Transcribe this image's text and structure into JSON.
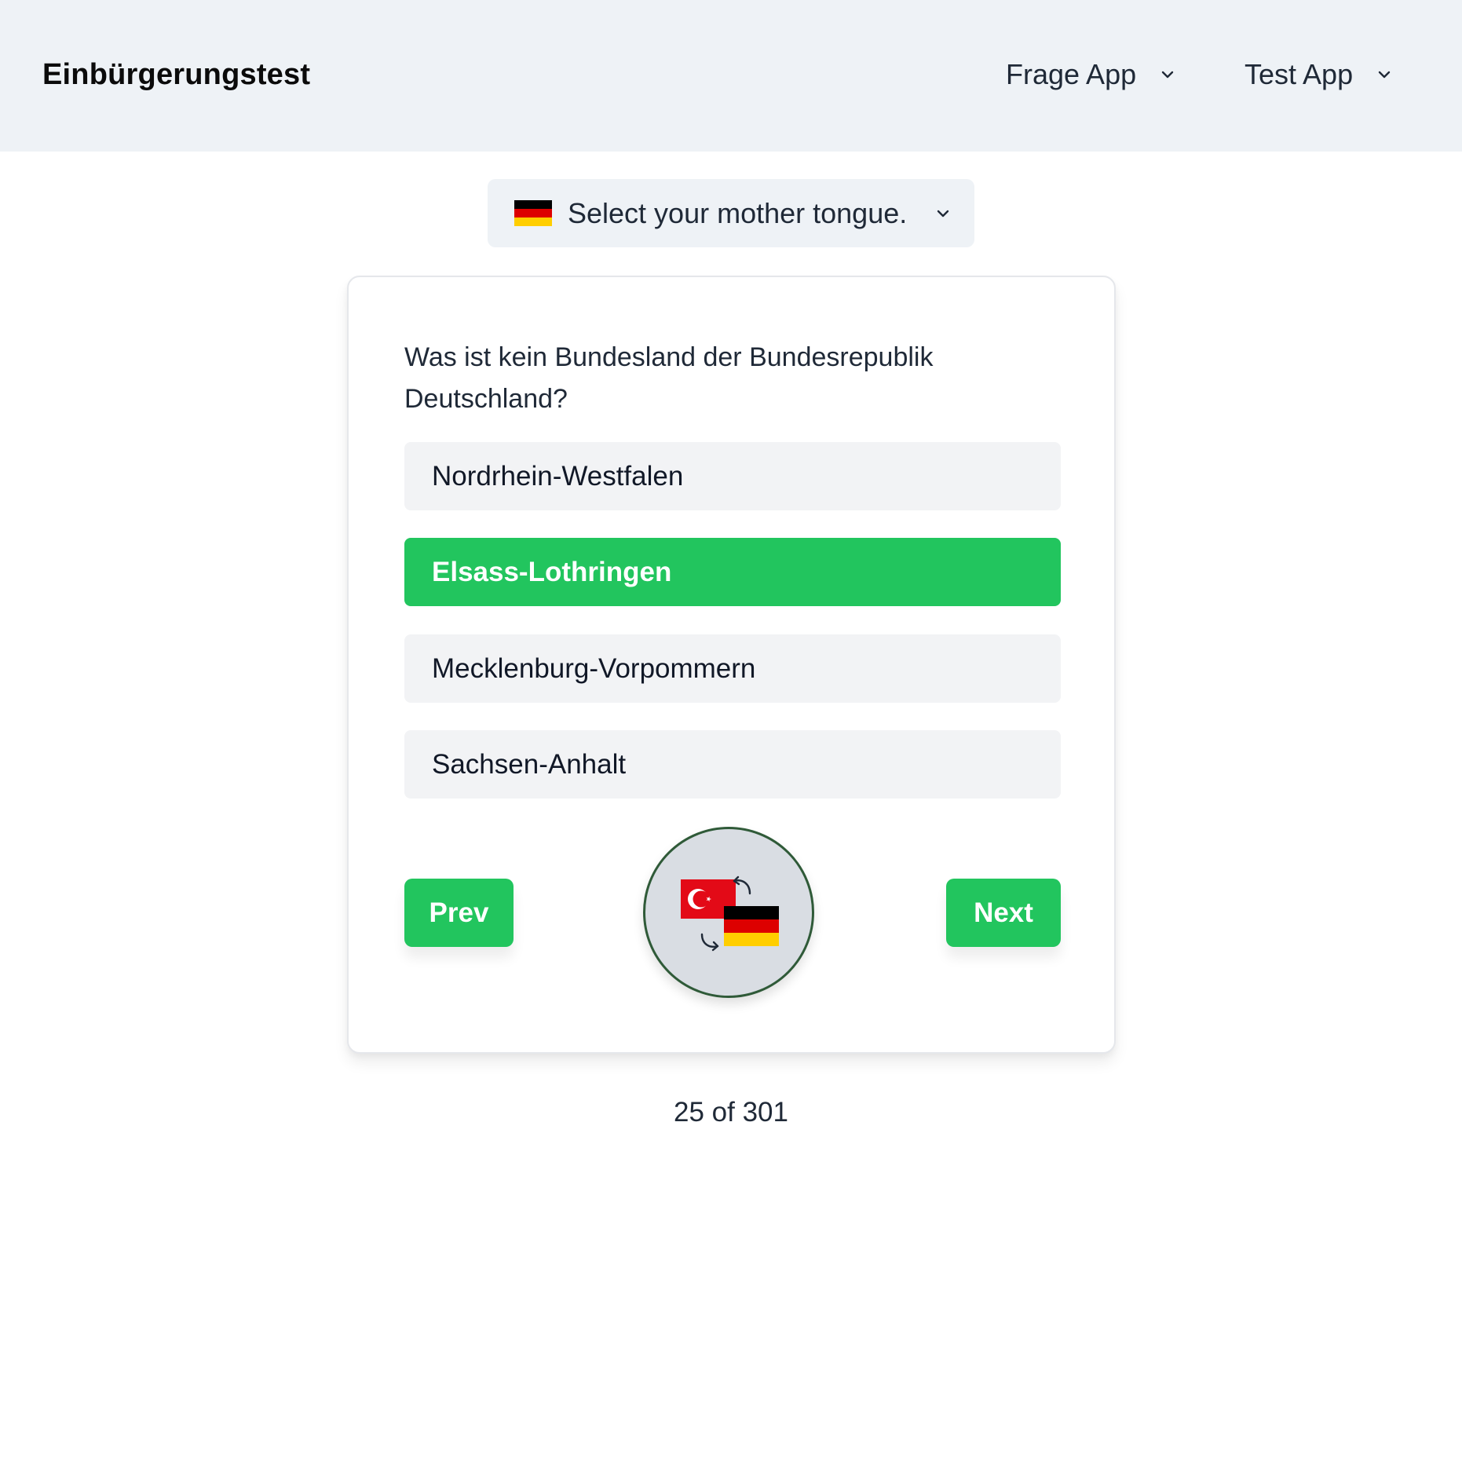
{
  "header": {
    "brand": "Einbürgerungstest",
    "menus": [
      {
        "label": "Frage App",
        "icon": "chevron-down-icon"
      },
      {
        "label": "Test App",
        "icon": "chevron-down-icon"
      }
    ]
  },
  "language_select": {
    "label": "Select your mother tongue.",
    "flag_icon": "germany-flag-icon",
    "icon": "chevron-down-icon"
  },
  "question": {
    "text": "Was ist kein Bundesland der Bundesrepublik Deutschland?",
    "answers": [
      {
        "label": "Nordrhein-Westfalen",
        "selected": false
      },
      {
        "label": "Elsass-Lothringen",
        "selected": true
      },
      {
        "label": "Mecklenburg-Vorpommern",
        "selected": false
      },
      {
        "label": "Sachsen-Anhalt",
        "selected": false
      }
    ]
  },
  "navigation": {
    "prev_label": "Prev",
    "next_label": "Next",
    "translate_icon": "turkish-german-translate-icon"
  },
  "progress": {
    "counter_text": "25 of 301",
    "current": 25,
    "total": 301
  },
  "colors": {
    "accent_green": "#22c55e",
    "header_bg": "#eef2f6",
    "answer_bg": "#f2f3f5"
  }
}
